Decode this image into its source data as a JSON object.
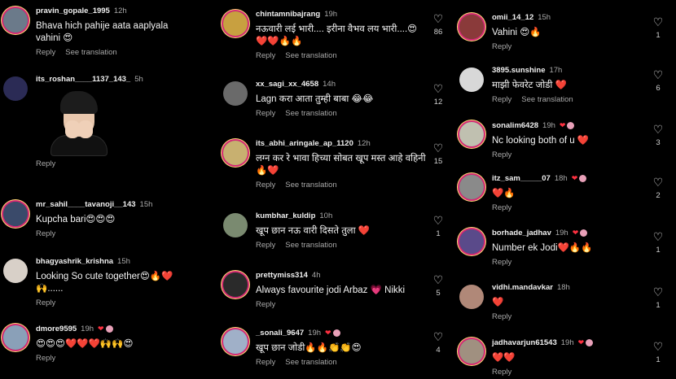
{
  "labels": {
    "reply": "Reply",
    "see_translation": "See translation"
  },
  "col1": [
    {
      "user": "pravin_gopale_1995",
      "time": "12h",
      "text": "Bhava hich pahije aata aaplyala vahini 😍",
      "translate": true,
      "color": "#6b7a8a"
    },
    {
      "user": "its_roshan____1137_143_",
      "time": "5h",
      "text": "",
      "translate": false,
      "sticker": true,
      "color": "#2b2b55"
    },
    {
      "user": "mr_sahil____tavanoji__143",
      "time": "15h",
      "text": "Kupcha bari😍😍😍",
      "translate": false,
      "color": "#3a4a6a"
    },
    {
      "user": "bhagyashrik_krishna",
      "time": "15h",
      "text": "Looking So cute together😍🔥❤️ 🙌......",
      "translate": false,
      "color": "#d8d0c8"
    },
    {
      "user": "dmore9595",
      "time": "19h",
      "text": "😍😍😍❤️❤️❤️🙌🙌😍",
      "translate": false,
      "creator": true,
      "color": "#8aa0b8"
    }
  ],
  "col2": [
    {
      "user": "chintamnibajrang",
      "time": "19h",
      "text": "नऊवारी लई भारी.... इरीना वैभव लय भारी....😍 ❤️❤️🔥🔥",
      "translate": true,
      "likes": "86",
      "color": "#c8a040"
    },
    {
      "user": "xx_sagi_xx_4658",
      "time": "14h",
      "text": "Lagn करा आता तुम्ही बाबा 😂😂",
      "translate": true,
      "likes": "12",
      "color": "#6a6a6a"
    },
    {
      "user": "its_abhi_aringale_ap_1120",
      "time": "12h",
      "text": "लग्न कर रे भावा हिच्या सोबत खूप मस्त आहे वहिनी🔥❤️",
      "translate": true,
      "likes": "15",
      "color": "#c8b070"
    },
    {
      "user": "kumbhar_kuldip",
      "time": "10h",
      "text": "खूप छान नऊ वारी दिसते तुला ❤️",
      "translate": true,
      "likes": "1",
      "color": "#7a8a70"
    },
    {
      "user": "prettymiss314",
      "time": "4h",
      "text": "Always favourite jodi Arbaz 💗 Nikki",
      "translate": false,
      "likes": "5",
      "color": "#2a2a2a"
    },
    {
      "user": "_sonali_9647",
      "time": "19h",
      "text": "खूप छान जोडी🔥🔥👏👏😍",
      "translate": true,
      "likes": "4",
      "creator": true,
      "color": "#a0b0c8"
    }
  ],
  "col3": [
    {
      "user": "omii_14_12",
      "time": "15h",
      "text": "Vahini 😍🔥",
      "likes": "1",
      "color": "#8a3a3a"
    },
    {
      "user": "3895.sunshine",
      "time": "17h",
      "text": "माझी फेवरेट जोडी ❤️",
      "translate": true,
      "likes": "6",
      "color": "#d8d8d8"
    },
    {
      "user": "sonalim6428",
      "time": "19h",
      "text": "Nc looking both of u ❤️",
      "likes": "3",
      "creator": true,
      "color": "#c0c0b0"
    },
    {
      "user": "itz_sam_____07",
      "time": "18h",
      "text": "❤️🔥",
      "likes": "2",
      "creator": true,
      "color": "#8a8a8a"
    },
    {
      "user": "borhade_jadhav",
      "time": "19h",
      "text": "Number ek Jodi❤️🔥🔥",
      "likes": "1",
      "creator": true,
      "color": "#5a4a8a"
    },
    {
      "user": "vidhi.mandavkar",
      "time": "18h",
      "text": "❤️",
      "likes": "1",
      "color": "#b08878"
    },
    {
      "user": "jadhavarjun61543",
      "time": "19h",
      "text": "❤️❤️",
      "likes": "1",
      "creator": true,
      "color": "#a09080"
    }
  ]
}
